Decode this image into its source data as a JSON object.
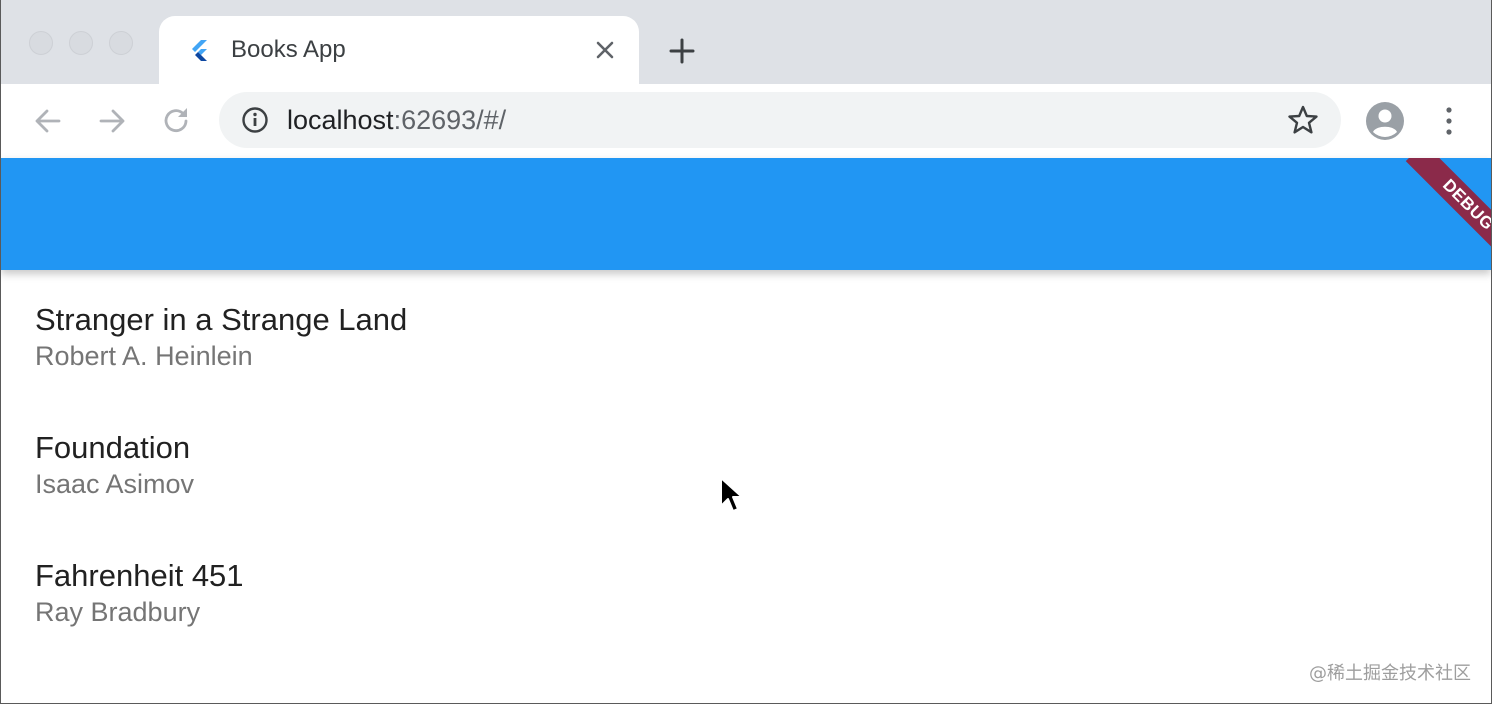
{
  "browser": {
    "tab": {
      "title": "Books App",
      "favicon": "flutter-logo-icon"
    },
    "new_tab_icon": "plus-icon",
    "toolbar": {
      "back_icon": "arrow-back-icon",
      "forward_icon": "arrow-forward-icon",
      "reload_icon": "reload-icon",
      "url_host": "localhost",
      "url_rest": ":62693/#/",
      "info_icon": "info-icon",
      "bookmark_icon": "star-icon",
      "profile_icon": "profile-icon",
      "menu_icon": "more-vert-icon"
    }
  },
  "app": {
    "appbar_color": "#2196f3",
    "debug_banner": "DEBUG",
    "debug_color": "#8b2a4a",
    "books": [
      {
        "title": "Stranger in a Strange Land",
        "author": "Robert A. Heinlein"
      },
      {
        "title": "Foundation",
        "author": "Isaac Asimov"
      },
      {
        "title": "Fahrenheit 451",
        "author": "Ray Bradbury"
      }
    ]
  },
  "watermark": "@稀土掘金技术社区"
}
